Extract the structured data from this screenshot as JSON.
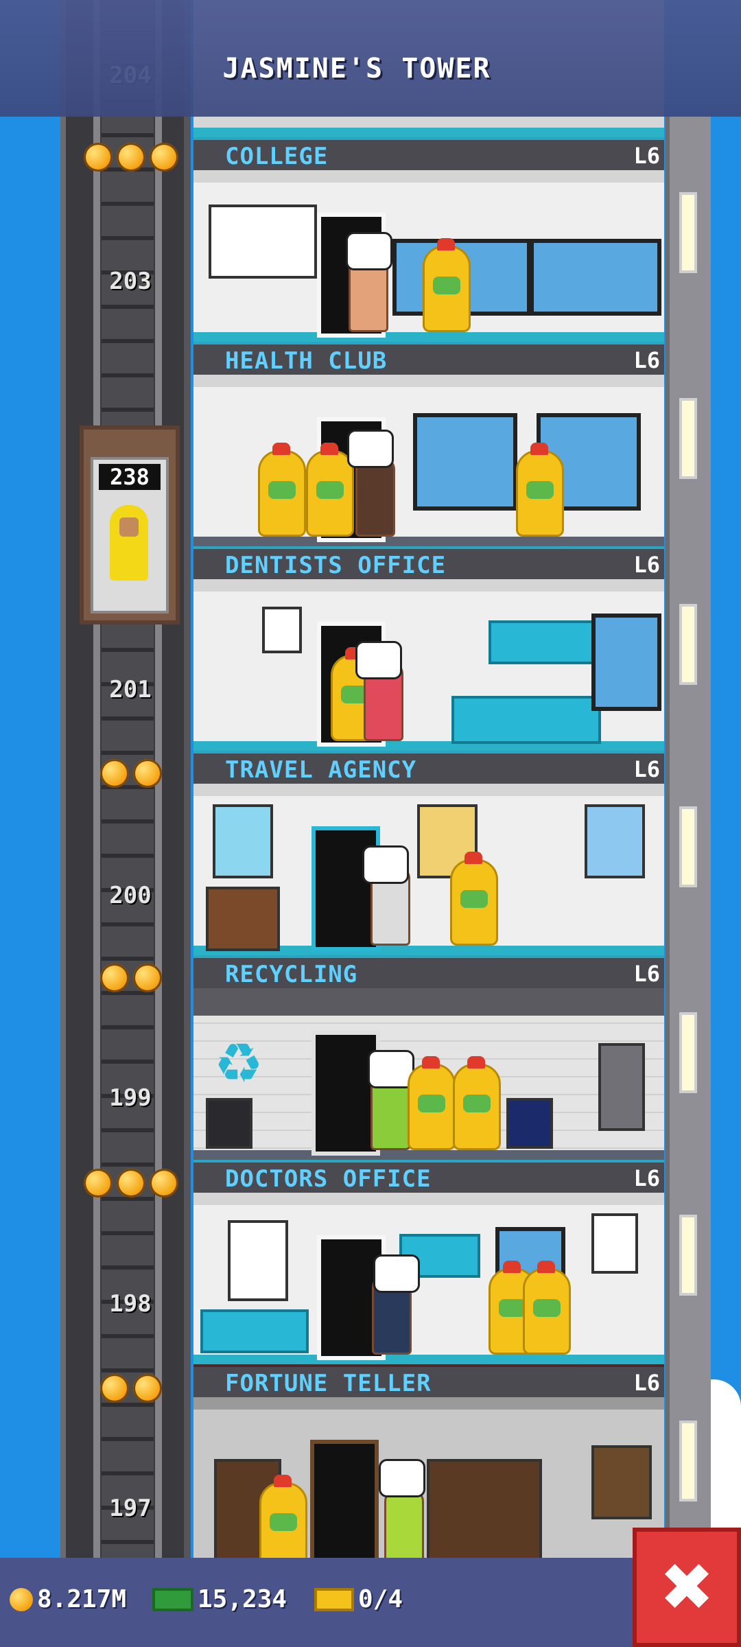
{
  "header": {
    "title": "JASMINE'S TOWER"
  },
  "elevator": {
    "display": "238"
  },
  "floors": [
    {
      "number": "204",
      "name": "",
      "level": ""
    },
    {
      "number": "203",
      "name": "COLLEGE",
      "level": "L6",
      "stars": 3
    },
    {
      "number": "",
      "name": "HEALTH CLUB",
      "level": "L6",
      "stars": 0
    },
    {
      "number": "201",
      "name": "DENTISTS OFFICE",
      "level": "L6",
      "stars": 0
    },
    {
      "number": "200",
      "name": "TRAVEL AGENCY",
      "level": "L6",
      "stars": 2
    },
    {
      "number": "199",
      "name": "RECYCLING",
      "level": "L6",
      "stars": 2
    },
    {
      "number": "198",
      "name": "DOCTORS OFFICE",
      "level": "L6",
      "stars": 3
    },
    {
      "number": "197",
      "name": "FORTUNE TELLER",
      "level": "L6",
      "stars": 2
    }
  ],
  "status": {
    "coins": "8.217M",
    "bux": "15,234",
    "tickets": "0/4"
  },
  "colors": {
    "sky": "#1f8fe6",
    "label_text": "#5fd0ff",
    "close_button": "#e23a3a"
  },
  "icons": {
    "coins": "coin-icon",
    "bux": "cash-icon",
    "tickets": "ticket-icon",
    "close": "close-icon"
  }
}
